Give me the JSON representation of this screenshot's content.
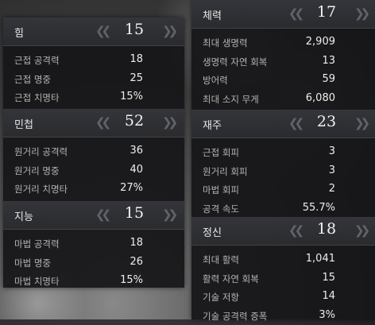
{
  "left_panel": {
    "sections": [
      {
        "title": "힘",
        "value": "15",
        "rows": [
          {
            "label": "근접 공격력",
            "value": "18"
          },
          {
            "label": "근접 명중",
            "value": "25"
          },
          {
            "label": "근접 치명타",
            "value": "15%"
          }
        ]
      },
      {
        "title": "민첩",
        "value": "52",
        "rows": [
          {
            "label": "원거리 공격력",
            "value": "36"
          },
          {
            "label": "원거리 명중",
            "value": "40"
          },
          {
            "label": "원거리 치명타",
            "value": "27%"
          }
        ]
      },
      {
        "title": "지능",
        "value": "15",
        "rows": [
          {
            "label": "마법 공격력",
            "value": "18"
          },
          {
            "label": "마법 명중",
            "value": "26"
          },
          {
            "label": "마법 치명타",
            "value": "15%"
          }
        ]
      }
    ]
  },
  "right_panel": {
    "sections": [
      {
        "title": "체력",
        "value": "17",
        "rows": [
          {
            "label": "최대 생명력",
            "value": "2,909"
          },
          {
            "label": "생명력 자연 회복",
            "value": "13"
          },
          {
            "label": "방어력",
            "value": "59"
          },
          {
            "label": "최대 소지 무게",
            "value": "6,080"
          }
        ]
      },
      {
        "title": "재주",
        "value": "23",
        "rows": [
          {
            "label": "근접 회피",
            "value": "3"
          },
          {
            "label": "원거리 회피",
            "value": "3"
          },
          {
            "label": "마법 회피",
            "value": "2"
          },
          {
            "label": "공격 속도",
            "value": "55.7%"
          }
        ]
      },
      {
        "title": "정신",
        "value": "18",
        "rows": [
          {
            "label": "최대 활력",
            "value": "1,041"
          },
          {
            "label": "활력 자연 회복",
            "value": "15"
          },
          {
            "label": "기술 저항",
            "value": "14"
          },
          {
            "label": "기술 공격력 증폭",
            "value": "3%"
          }
        ]
      }
    ]
  },
  "icons": {
    "decrease": "chevron-double-left-icon",
    "increase": "chevron-double-right-icon"
  }
}
